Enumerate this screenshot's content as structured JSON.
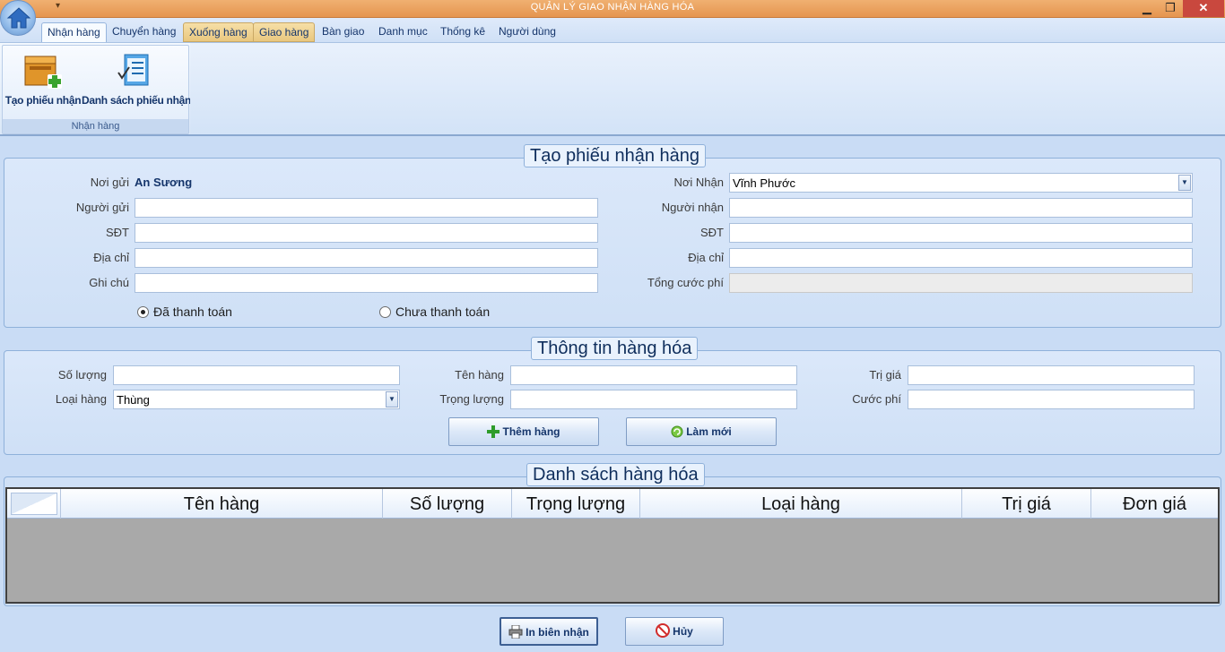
{
  "window": {
    "title": "QUẢN LÝ GIAO NHẬN HÀNG HÓA",
    "quick_access": "▾",
    "minimize": "▁",
    "maximize": "❐",
    "close": "✕"
  },
  "tabs": [
    {
      "label": "Nhận hàng",
      "state": "active"
    },
    {
      "label": "Chuyển hàng",
      "state": "normal"
    },
    {
      "label": "Xuống hàng",
      "state": "highlighted"
    },
    {
      "label": "Giao hàng",
      "state": "highlighted"
    },
    {
      "label": "Bàn giao",
      "state": "normal"
    },
    {
      "label": "Danh mục",
      "state": "normal"
    },
    {
      "label": "Thống kê",
      "state": "normal"
    },
    {
      "label": "Người dùng",
      "state": "normal"
    }
  ],
  "ribbon": {
    "group_label": "Nhận hàng",
    "buttons": [
      {
        "label": "Tạo phiếu nhận",
        "icon": "box-add-icon"
      },
      {
        "label": "Danh sách phiếu nhận",
        "icon": "checklist-icon"
      }
    ]
  },
  "receipt_form": {
    "title": "Tạo phiếu nhận hàng",
    "sender_place_label": "Nơi gửi",
    "sender_place_value": "An Sương",
    "sender_label": "Người gửi",
    "sender_value": "",
    "sender_phone_label": "SĐT",
    "sender_phone_value": "",
    "sender_address_label": "Địa chỉ",
    "sender_address_value": "",
    "note_label": "Ghi chú",
    "note_value": "",
    "receiver_place_label": "Nơi Nhận",
    "receiver_place_value": "Vĩnh Phước",
    "receiver_label": "Người nhận",
    "receiver_value": "",
    "receiver_phone_label": "SĐT",
    "receiver_phone_value": "",
    "receiver_address_label": "Địa chỉ",
    "receiver_address_value": "",
    "total_fee_label": "Tổng cước phí",
    "total_fee_value": "",
    "payment_options": [
      {
        "label": "Đã thanh toán",
        "selected": true
      },
      {
        "label": "Chưa thanh toán",
        "selected": false
      }
    ]
  },
  "goods_form": {
    "title": "Thông tin hàng hóa",
    "quantity_label": "Số lượng",
    "quantity_value": "",
    "type_label": "Loại hàng",
    "type_value": "Thùng",
    "name_label": "Tên hàng",
    "name_value": "",
    "weight_label": "Trọng lượng",
    "weight_value": "",
    "value_label": "Trị giá",
    "value_value": "",
    "fee_label": "Cước phí",
    "fee_value": "",
    "add_button": "Thêm hàng",
    "reset_button": "Làm mới"
  },
  "goods_list": {
    "title": "Danh sách hàng hóa",
    "columns": [
      "Tên hàng",
      "Số lượng",
      "Trọng lượng",
      "Loại hàng",
      "Trị giá",
      "Đơn giá"
    ],
    "rows": []
  },
  "footer": {
    "print_button": "In biên nhận",
    "cancel_button": "Hủy"
  },
  "colors": {
    "titlebar": "#e5954f",
    "background": "#c9dcf5",
    "accent_text": "#15356b",
    "grid_empty": "#a9a9a9"
  }
}
